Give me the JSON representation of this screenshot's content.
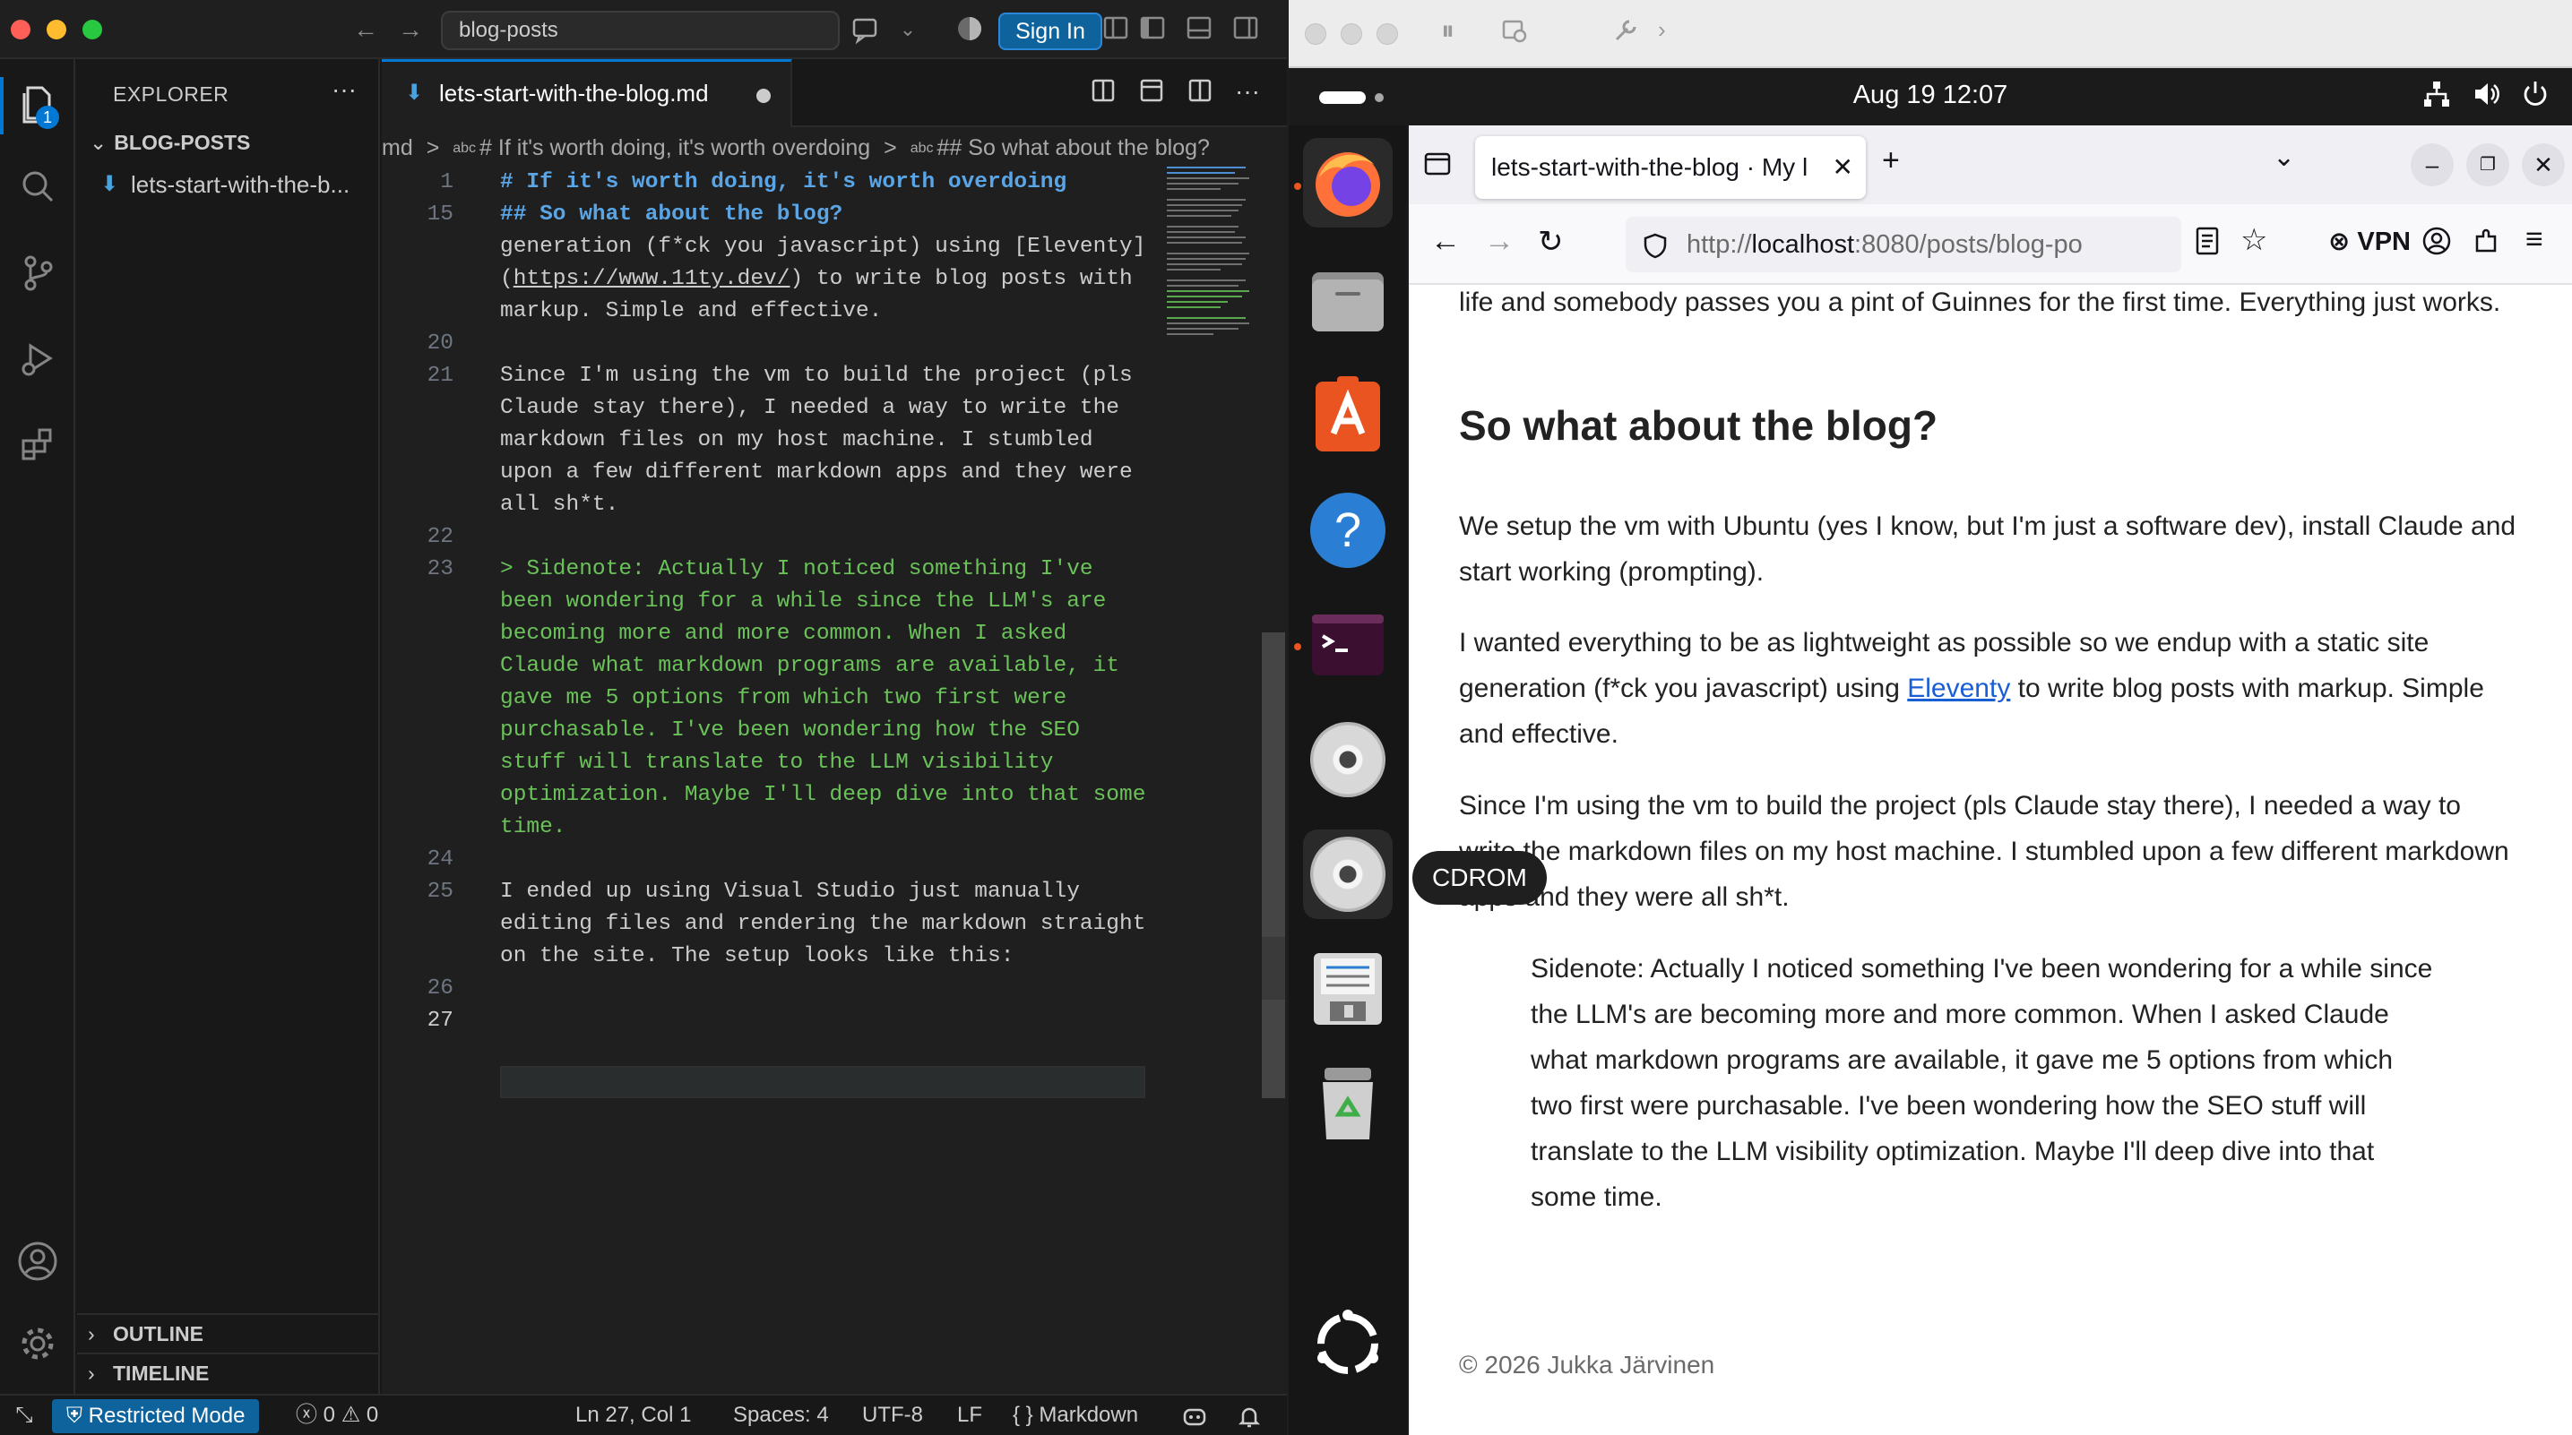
{
  "vscode": {
    "search_text": "blog-posts",
    "signin_label": "Sign In",
    "explorer": {
      "title": "EXPLORER",
      "folder": "BLOG-POSTS",
      "file": "lets-start-with-the-b...",
      "outline": "OUTLINE",
      "timeline": "TIMELINE",
      "badge": "1"
    },
    "tab": {
      "label": "lets-start-with-the-blog.md"
    },
    "breadcrumb": [
      "md",
      "# If it's worth doing, it's worth overdoing",
      "## So what about the blog?"
    ],
    "breadcrumb_separator": ">",
    "breadcrumb_abc": "abc",
    "code_lines": [
      {
        "n": "1",
        "t": "# If it's worth doing, it's worth overdoing",
        "k": "head"
      },
      {
        "n": "15",
        "t": "## So what about the blog?",
        "k": "head"
      },
      {
        "n": "",
        "t": "generation (f*ck you javascript) using [Eleventy]",
        "k": "text"
      },
      {
        "n": "",
        "t": "(https://www.11ty.dev/) to write blog posts with",
        "k": "text"
      },
      {
        "n": "",
        "t": "markup. Simple and effective.",
        "k": "text"
      },
      {
        "n": "20",
        "t": "",
        "k": "text"
      },
      {
        "n": "21",
        "t": "Since I'm using the vm to build the project (pls",
        "k": "text"
      },
      {
        "n": "",
        "t": "Claude stay there), I needed a way to write the",
        "k": "text"
      },
      {
        "n": "",
        "t": "markdown files on my host machine. I stumbled",
        "k": "text"
      },
      {
        "n": "",
        "t": "upon a few different markdown apps and they were",
        "k": "text"
      },
      {
        "n": "",
        "t": "all sh*t.",
        "k": "text"
      },
      {
        "n": "22",
        "t": "",
        "k": "text"
      },
      {
        "n": "23",
        "t": "> Sidenote: Actually I noticed something I've",
        "k": "quote"
      },
      {
        "n": "",
        "t": "been wondering for a while since the LLM's are",
        "k": "quote"
      },
      {
        "n": "",
        "t": "becoming more and more common. When I asked",
        "k": "quote"
      },
      {
        "n": "",
        "t": "Claude what markdown programs are available, it",
        "k": "quote"
      },
      {
        "n": "",
        "t": "gave me 5 options from which two first were",
        "k": "quote"
      },
      {
        "n": "",
        "t": "purchasable. I've been wondering how the SEO",
        "k": "quote"
      },
      {
        "n": "",
        "t": "stuff will translate to the LLM visibility",
        "k": "quote"
      },
      {
        "n": "",
        "t": "optimization. Maybe I'll deep dive into that some",
        "k": "quote"
      },
      {
        "n": "",
        "t": "time.",
        "k": "quote"
      },
      {
        "n": "24",
        "t": "",
        "k": "text"
      },
      {
        "n": "25",
        "t": "I ended up using Visual Studio just manually",
        "k": "text"
      },
      {
        "n": "",
        "t": "editing files and rendering the markdown straight",
        "k": "text"
      },
      {
        "n": "",
        "t": "on the site. The setup looks like this:",
        "k": "text"
      },
      {
        "n": "26",
        "t": "",
        "k": "text"
      },
      {
        "n": "27",
        "t": "",
        "k": "text"
      }
    ],
    "status": {
      "restricted": "Restricted Mode",
      "errors": "0",
      "warnings": "0",
      "position": "Ln 27, Col 1",
      "spaces": "Spaces: 4",
      "encoding": "UTF-8",
      "eol": "LF",
      "braces": "{ }",
      "language": "Markdown"
    }
  },
  "ubuntu": {
    "clock": "Aug 19  12:07",
    "dock_tooltip": "CDROM",
    "firefox": {
      "tab_title": "lets-start-with-the-blog · My l",
      "url_prefix": "http://",
      "url_host": "localhost",
      "url_rest": ":8080/posts/blog-po",
      "vpn_label": "VPN"
    },
    "page": {
      "p_top": "life and somebody passes you a pint of Guinnes for the first time. Everything just works.",
      "h2": "So what about the blog?",
      "p1": "We setup the vm with Ubuntu (yes I know, but I'm just a software dev), install Claude and start working (prompting).",
      "p2_before": "I wanted everything to be as lightweight as possible so we endup with a static site generation (f*ck you javascript) using ",
      "p2_link": "Eleventy",
      "p2_after": " to write blog posts with markup. Simple and effective.",
      "p3": "Since I'm using the vm to build the project (pls Claude stay there), I needed a way to write the markdown files on my host machine. I stumbled upon a few different markdown apps and they were all sh*t.",
      "blockquote": "Sidenote: Actually I noticed something I've been wondering for a while since the LLM's are becoming more and more common. When I asked Claude what markdown programs are available, it gave me 5 options from which two first were purchasable. I've been wondering how the SEO stuff will translate to the LLM visibility optimization. Maybe I'll deep dive into that some time.",
      "footer": "© 2026 Jukka Järvinen"
    }
  },
  "colors": {
    "vscode_accent": "#0078d4",
    "restricted_bg": "#0e639c",
    "md_heading": "#5aa5e6",
    "md_quote": "#6ac259",
    "link": "#1a5ed6",
    "ubuntu_orange": "#e95420"
  }
}
